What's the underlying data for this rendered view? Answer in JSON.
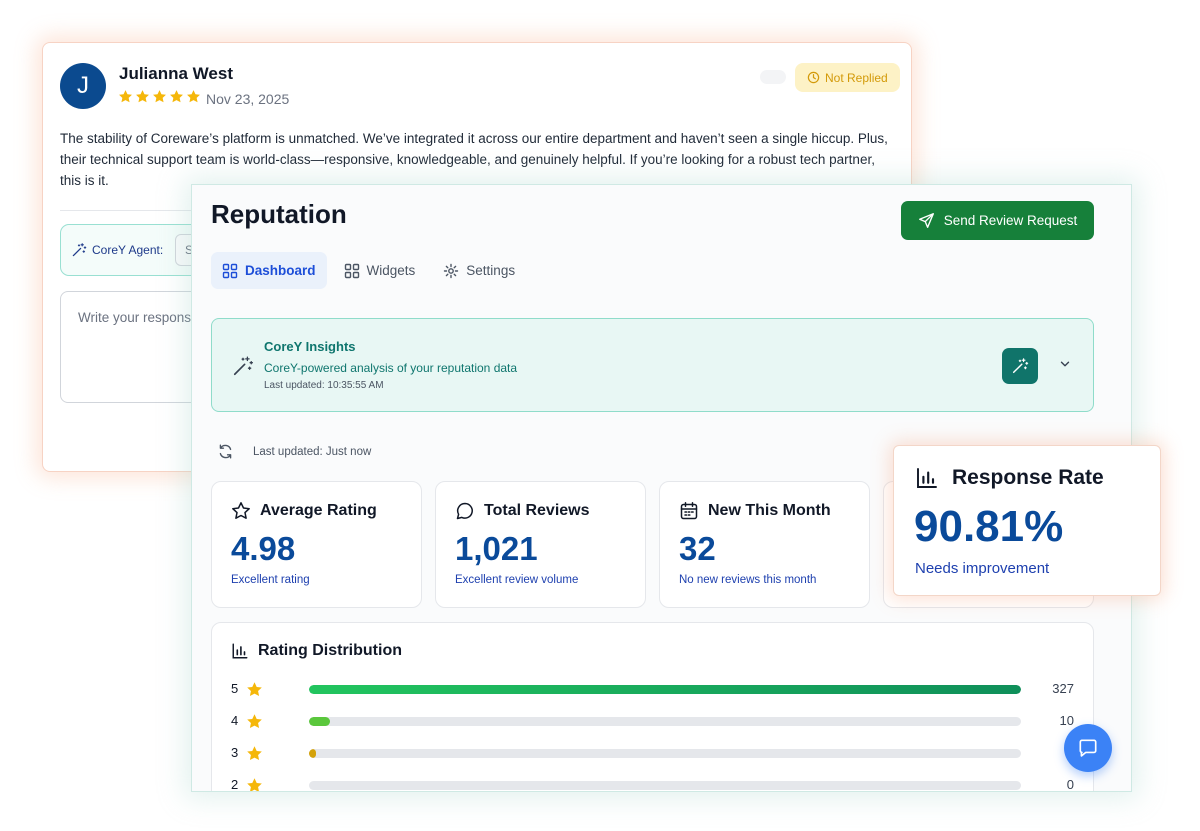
{
  "review": {
    "avatar_initial": "J",
    "reviewer_name": "Julianna West",
    "rating": 5,
    "date": "Nov 23, 2025",
    "status_badge": "Not Replied",
    "text": "The stability of Coreware’s platform is unmatched. We’ve integrated it across our entire department and haven’t seen a single hiccup. Plus, their technical support team is world-class—responsive, knowledgeable, and genuinely helpful. If you’re looking for a robust tech partner, this is it.",
    "agent_label": "CoreY Agent:",
    "agent_select_value": "S",
    "response_placeholder": "Write your respons"
  },
  "dashboard": {
    "title": "Reputation",
    "send_button_label": "Send Review Request",
    "tabs": [
      {
        "label": "Dashboard",
        "icon": "grid-icon",
        "active": true
      },
      {
        "label": "Widgets",
        "icon": "widgets-icon",
        "active": false
      },
      {
        "label": "Settings",
        "icon": "gear-icon",
        "active": false
      }
    ],
    "insights": {
      "title": "CoreY Insights",
      "subtitle": "CoreY-powered analysis of your reputation data",
      "updated": "Last updated: 10:35:55 AM"
    },
    "last_updated": "Last updated: Just now",
    "stats": [
      {
        "title": "Average Rating",
        "icon": "star-outline-icon",
        "value": "4.98",
        "sub": "Excellent rating"
      },
      {
        "title": "Total Reviews",
        "icon": "chat-bubble-icon",
        "value": "1,021",
        "sub": "Excellent review volume"
      },
      {
        "title": "New This Month",
        "icon": "calendar-icon",
        "value": "32",
        "sub": "No new reviews this month"
      }
    ],
    "distribution": {
      "title": "Rating Distribution",
      "rows": [
        {
          "stars": "5",
          "count": "327",
          "fraction": 1.0,
          "color": "#16a34a"
        },
        {
          "stars": "4",
          "count": "10",
          "fraction": 0.03,
          "color": "#5ac73c"
        },
        {
          "stars": "3",
          "count": "",
          "fraction": 0.01,
          "color": "#d4a20a"
        },
        {
          "stars": "2",
          "count": "0",
          "fraction": 0.0,
          "color": "#e5e7eb"
        }
      ]
    }
  },
  "response_rate": {
    "title": "Response Rate",
    "value": "90.81%",
    "sub": "Needs improvement"
  },
  "colors": {
    "brand_green": "#16803a",
    "accent_blue": "#0a4a9a",
    "teal": "#10746a",
    "star_yellow": "#f5b70a"
  }
}
